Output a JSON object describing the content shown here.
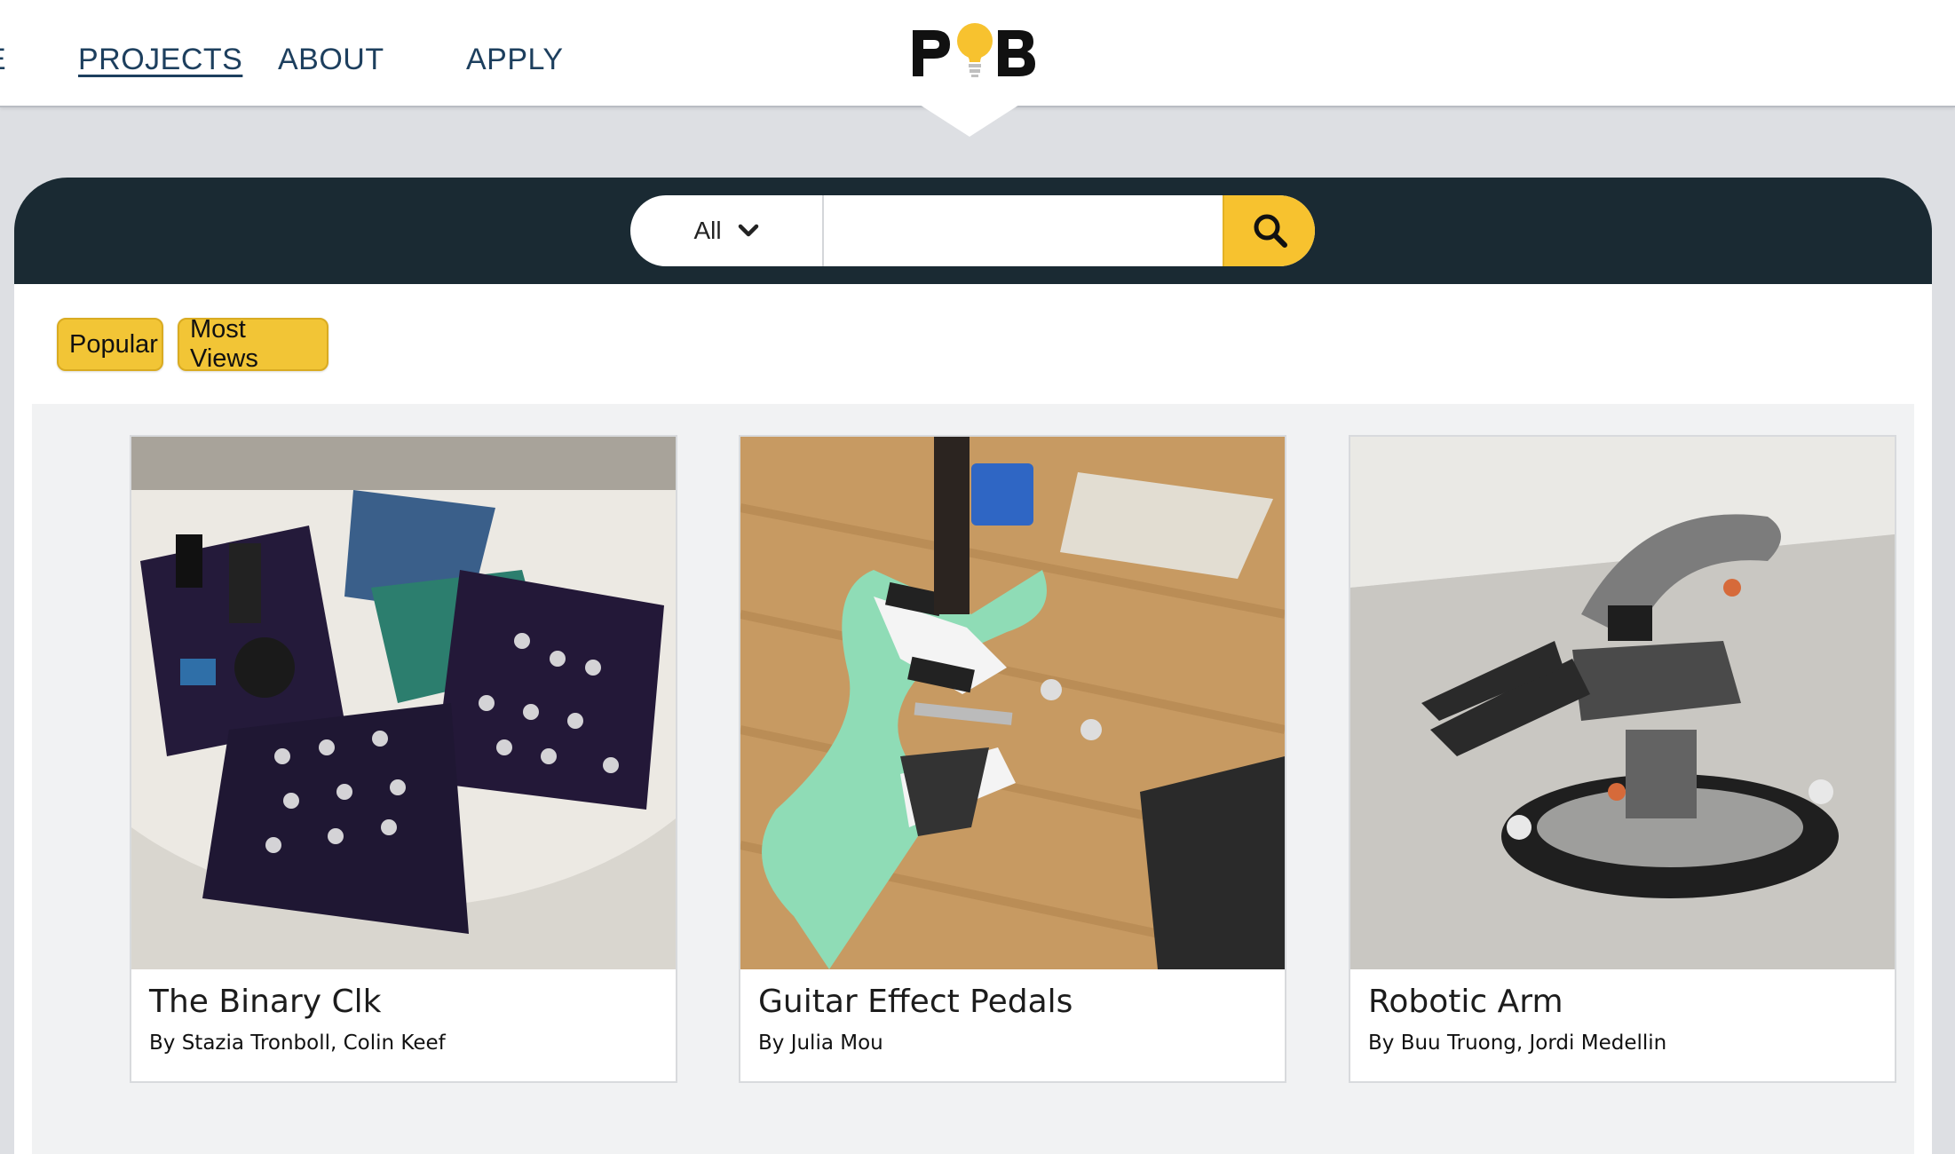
{
  "nav": {
    "cut_item": "E",
    "items": [
      {
        "label": "PROJECTS",
        "active": true
      },
      {
        "label": "ABOUT",
        "active": false
      },
      {
        "label": "APPLY",
        "active": false
      }
    ]
  },
  "logo": {
    "text": "PoB",
    "accent_color": "#f7c22f"
  },
  "search": {
    "category_selected": "All",
    "query": "",
    "button_icon": "search-icon"
  },
  "filters": [
    {
      "label": "Popular"
    },
    {
      "label": "Most Views"
    }
  ],
  "projects": [
    {
      "title": "The Binary Clk",
      "author": "By Stazia Tronboll, Colin Keef",
      "image": "circuit-boards-photo"
    },
    {
      "title": "Guitar Effect Pedals",
      "author": "By Julia Mou",
      "image": "green-guitar-photo"
    },
    {
      "title": "Robotic Arm",
      "author": "By Buu Truong, Jordi Medellin",
      "image": "robotic-arm-photo"
    }
  ],
  "colors": {
    "nav_text": "#1d3f5e",
    "search_bar_bg": "#1a2a33",
    "accent_yellow": "#f7c22f",
    "page_bg": "#dddfe3"
  }
}
